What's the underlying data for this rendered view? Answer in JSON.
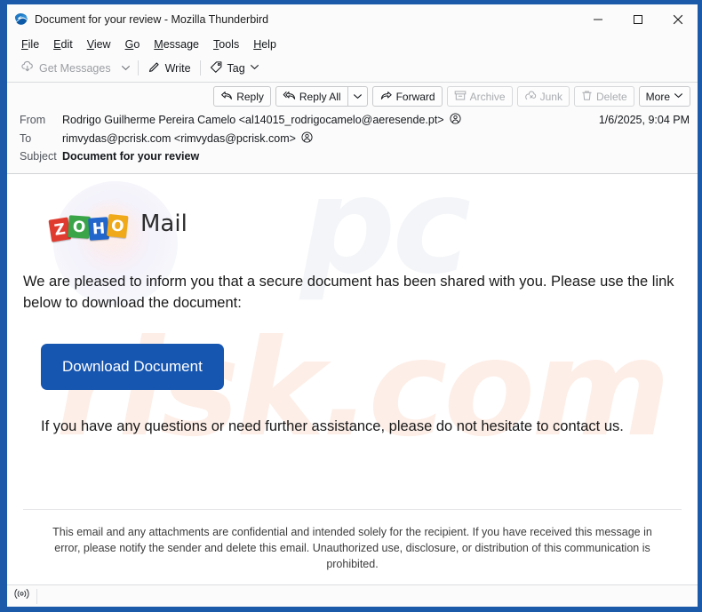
{
  "window": {
    "title": "Document for your review - Mozilla Thunderbird",
    "app_icon": "thunderbird-icon",
    "controls": {
      "minimize": "minimize-icon",
      "maximize": "maximize-icon",
      "close": "close-icon"
    }
  },
  "menubar": {
    "items": [
      {
        "label": "File",
        "accel": "F"
      },
      {
        "label": "Edit",
        "accel": "E"
      },
      {
        "label": "View",
        "accel": "V"
      },
      {
        "label": "Go",
        "accel": "G"
      },
      {
        "label": "Message",
        "accel": "M"
      },
      {
        "label": "Tools",
        "accel": "T"
      },
      {
        "label": "Help",
        "accel": "H"
      }
    ]
  },
  "toolbar": {
    "get_messages_label": "Get Messages",
    "write_label": "Write",
    "tag_label": "Tag"
  },
  "message_actions": [
    {
      "label": "Reply",
      "icon": "reply-icon",
      "disabled": false
    },
    {
      "label": "Reply All",
      "icon": "reply-all-icon",
      "disabled": false
    },
    {
      "label": "Forward",
      "icon": "forward-icon",
      "disabled": false
    },
    {
      "label": "Archive",
      "icon": "archive-icon",
      "disabled": true
    },
    {
      "label": "Junk",
      "icon": "junk-icon",
      "disabled": true
    },
    {
      "label": "Delete",
      "icon": "trash-icon",
      "disabled": true
    },
    {
      "label": "More",
      "icon": "chevron-down-icon",
      "disabled": false
    }
  ],
  "headers": {
    "from_label": "From",
    "from_value": "Rodrigo Guilherme Pereira Camelo <al14015_rodrigocamelo@aeresende.pt>",
    "to_label": "To",
    "to_value": "rimvydas@pcrisk.com <rimvydas@pcrisk.com>",
    "subject_label": "Subject",
    "subject_value": "Document for your review",
    "date": "1/6/2025, 9:04 PM"
  },
  "body": {
    "brand": {
      "tiles": [
        {
          "letter": "Z",
          "color": "#e03b2f"
        },
        {
          "letter": "O",
          "color": "#3aa548"
        },
        {
          "letter": "H",
          "color": "#2266cc"
        },
        {
          "letter": "O",
          "color": "#f0a918"
        }
      ],
      "word": "Mail"
    },
    "paragraph_intro": "We are pleased to inform you that a secure document has been shared with you. Please use the link below to download the document:",
    "download_button_label": "Download Document",
    "download_button_color": "#1756b0",
    "paragraph_contact": "If you have any questions or need further assistance, please do not hesitate to contact us.",
    "footer_disclaimer": "This email and any attachments are confidential and intended solely for the recipient. If you have received this message in error, please notify the sender and delete this email. Unauthorized use, disclosure, or distribution of this communication is prohibited."
  },
  "watermark": {
    "text_top": "pc",
    "text_bottom": "risk.com"
  },
  "statusbar": {
    "icon": "broadcast-icon",
    "text": ""
  }
}
